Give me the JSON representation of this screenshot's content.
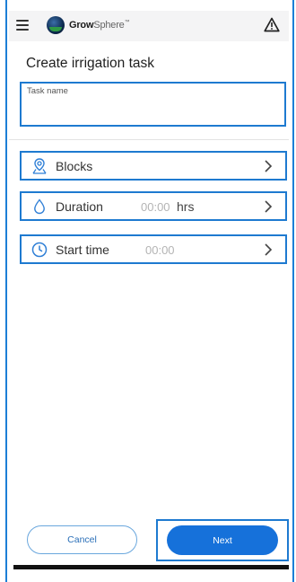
{
  "app_bar": {
    "menu_icon": "menu-icon",
    "logo": {
      "brand_bold": "Grow",
      "brand_light": "Sphere",
      "trademark": "™"
    },
    "alert_icon": "warning-triangle-icon"
  },
  "page": {
    "title": "Create irrigation task"
  },
  "task_name": {
    "placeholder": "Task name",
    "value": ""
  },
  "rows": [
    {
      "label": "Blocks",
      "value": "",
      "unit": "",
      "icon": "map-pin-icon"
    },
    {
      "label": "Duration",
      "value": "00:00",
      "unit": "hrs",
      "icon": "water-drop-icon"
    },
    {
      "label": "Start time",
      "value": "00:00",
      "unit": "",
      "icon": "clock-icon"
    }
  ],
  "actions": {
    "cancel_label": "Cancel",
    "next_label": "Next"
  },
  "colors": {
    "accent": "#1671da",
    "highlight_border": "#1e7ad0",
    "app_bar_bg": "#f4f4f5"
  }
}
